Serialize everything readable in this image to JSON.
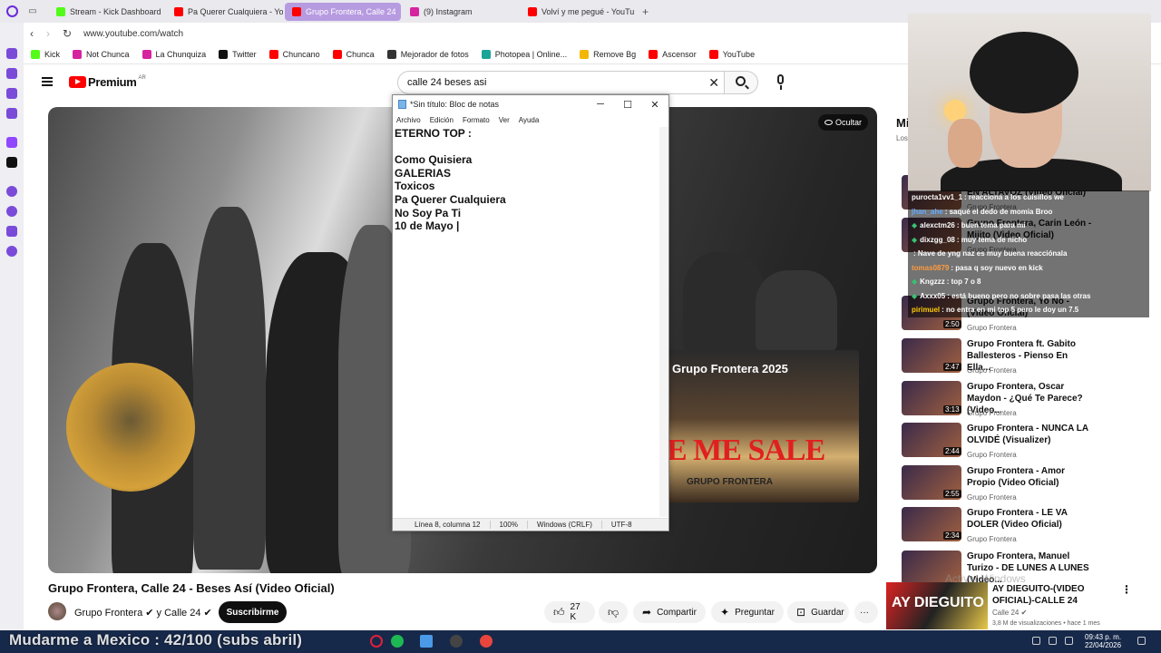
{
  "browser": {
    "tabs": [
      {
        "label": "Stream - Kick Dashboard",
        "color": "#53fc18",
        "active": false
      },
      {
        "label": "Pa Querer Cualquiera - Yo",
        "color": "#ff0000",
        "active": false
      },
      {
        "label": "Grupo Frontera, Calle 24",
        "color": "#ff0000",
        "active": true
      },
      {
        "label": "(9) Instagram",
        "color": "#d6249f",
        "active": false
      },
      {
        "label": "Volví y me pegué - YouTu",
        "color": "#ff0000",
        "active": false
      }
    ],
    "new_tab": "+",
    "url": "www.youtube.com/watch",
    "bookmarks": [
      {
        "label": "Kick",
        "color": "#53fc18"
      },
      {
        "label": "Not Chunca",
        "color": "#d6249f"
      },
      {
        "label": "La Chunquiza",
        "color": "#d6249f"
      },
      {
        "label": "Twitter",
        "color": "#111111"
      },
      {
        "label": "Chuncano",
        "color": "#ff0000"
      },
      {
        "label": "Chunca",
        "color": "#ff0000"
      },
      {
        "label": "Mejorador de fotos",
        "color": "#333333"
      },
      {
        "label": "Photopea | Online...",
        "color": "#18a497"
      },
      {
        "label": "Remove Bg",
        "color": "#f2b705"
      },
      {
        "label": "Ascensor",
        "color": "#ff0000"
      },
      {
        "label": "YouTube",
        "color": "#ff0000"
      }
    ]
  },
  "youtube": {
    "logo_text": "Premium",
    "logo_sup": "AR",
    "search_value": "calle 24 beses asi",
    "player": {
      "hide_label": "Ocultar",
      "endcard_title": "Grupo Frontera 2025",
      "endcard_text": "E ME SALE",
      "endcard_sub": "GRUPO FRONTERA"
    },
    "video_title": "Grupo Frontera, Calle 24 - Beses Así (Video Oficial)",
    "channel": "Grupo Frontera ✔ y Calle 24 ✔",
    "subscribe": "Suscribirme",
    "likes": "27 K",
    "share": "Compartir",
    "ask": "Preguntar",
    "save": "Guardar",
    "more": "···",
    "right_head": "Mi",
    "right_sub": "Los",
    "recommendations": [
      {
        "title": "Grupo Frontera, Junior H - EN ALTAVOZ (Video Oficial)",
        "channel": "Grupo Frontera",
        "duration": ""
      },
      {
        "title": "Grupo Frontera, Carin León - Mijito (Video Oficial)",
        "channel": "Grupo Frontera",
        "duration": ""
      },
      {
        "title": "Grupo Frontera, Yo No - (Video Oficial)",
        "channel": "Grupo Frontera",
        "duration": "2:50"
      },
      {
        "title": "Grupo Frontera ft. Gabito Ballesteros - Pienso En Ella...",
        "channel": "Grupo Frontera",
        "duration": "2:47"
      },
      {
        "title": "Grupo Frontera, Oscar Maydon - ¿Qué Te Parece? (Video...",
        "channel": "Grupo Frontera",
        "duration": "3:13"
      },
      {
        "title": "Grupo Frontera - NUNCA LA OLVIDÉ (Visualizer)",
        "channel": "Grupo Frontera",
        "duration": "2:44"
      },
      {
        "title": "Grupo Frontera - Amor Propio (Video Oficial)",
        "channel": "Grupo Frontera",
        "duration": "2:55"
      },
      {
        "title": "Grupo Frontera - LE VA DOLER (Video Oficial)",
        "channel": "Grupo Frontera",
        "duration": "2:34"
      },
      {
        "title": "Grupo Frontera, Manuel Turizo - DE LUNES A LUNES (Video...",
        "channel": "",
        "duration": ""
      }
    ],
    "mini": {
      "thumb_text": "AY DIEGUITO",
      "title": "AY DIEGUITO-(VIDEO OFICIAL)-CALLE 24",
      "channel": "Calle 24 ✔",
      "views": "3,8 M de visualizaciones • hace 1 mes"
    },
    "watermark": "Activar Windows"
  },
  "notepad": {
    "title": "*Sin título: Bloc de notas",
    "minimize": "─",
    "maximize": "☐",
    "close": "✕",
    "menu": [
      "Archivo",
      "Edición",
      "Formato",
      "Ver",
      "Ayuda"
    ],
    "lines": [
      "ETERNO TOP :",
      "",
      "Como Quisiera",
      "GALERIAS",
      "Toxicos",
      "Pa Querer Cualquiera",
      "No Soy Pa Ti",
      "10 de Mayo |"
    ],
    "status": {
      "position": "Línea 8, columna 12",
      "zoom": "100%",
      "eol": "Windows (CRLF)",
      "encoding": "UTF-8"
    }
  },
  "chat": [
    {
      "user": "purocta1vv1_1",
      "msg": ": reacciona a los cuisillos we",
      "user_color": "#ffffff"
    },
    {
      "user": "jhan_ahe",
      "msg": ": saqué el dedo de momia Broo",
      "user_color": "#66aaff"
    },
    {
      "user": "alexctm26",
      "msg": ": buen tema para mi",
      "user_color": "#ffffff"
    },
    {
      "user": "dixzgg_08",
      "msg": ": muy tema de nicho",
      "user_color": "#ffffff"
    },
    {
      "user": "",
      "msg": ": Nave de yng naz es muy buena reacciónala",
      "user_color": "#ffffff"
    },
    {
      "user": "tomas0879",
      "msg": ": pasa q soy nuevo en kick",
      "user_color": "#ff9a3c"
    },
    {
      "user": "Kngzzz",
      "msg": ": top 7 o 8",
      "user_color": "#ffffff"
    },
    {
      "user": "Axxx05",
      "msg": ": está bueno pero no sobre pasa las otras",
      "user_color": "#ffffff"
    },
    {
      "user": "pirimuel",
      "msg": ": no entra en mi top 5 pero le doy un 7.5",
      "user_color": "#ffcc00"
    }
  ],
  "taskbar": {
    "marquee": "Mudarme a Mexico : 42/100 (subs abril)",
    "time": "09:43 p. m.",
    "date": "22/04/2026"
  }
}
